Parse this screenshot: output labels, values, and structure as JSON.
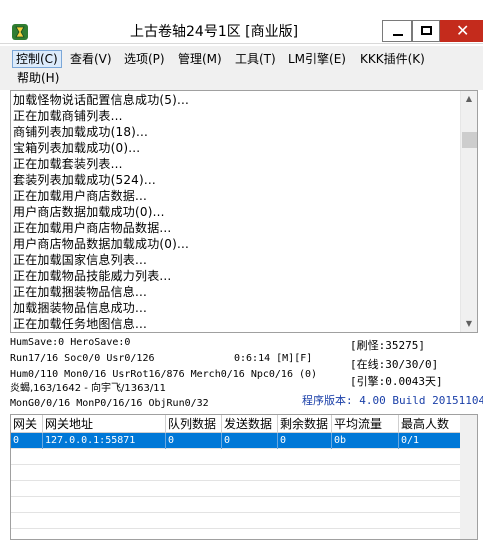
{
  "window": {
    "title": "上古卷轴24号1区 [商业版]",
    "close_glyph": "✕"
  },
  "menu": [
    {
      "label": "控制(C)",
      "active": true
    },
    {
      "label": "查看(V)"
    },
    {
      "label": "选项(P)"
    },
    {
      "label": "管理(M)"
    },
    {
      "label": "工具(T)"
    },
    {
      "label": "LM引擎(E)"
    },
    {
      "label": "KKK插件(K)"
    },
    {
      "label": "帮助(H)"
    }
  ],
  "log": [
    "加载怪物说话配置信息成功(5)...",
    "正在加载商铺列表...",
    "商铺列表加载成功(18)...",
    "宝箱列表加载成功(0)...",
    "正在加载套装列表...",
    "套装列表加载成功(524)...",
    "正在加载用户商店数据...",
    "用户商店数据加载成功(0)...",
    "正在加载用户商店物品数据...",
    "用户商店物品数据加载成功(0)...",
    "正在加载国家信息列表...",
    "正在加载物品技能威力列表...",
    "正在加载捆装物品信息...",
    "加载捆装物品信息成功...",
    "正在加载任务地图信息..."
  ],
  "status": {
    "line1": "HumSave:0 HeroSave:0",
    "line2_left": "Run17/16 Soc0/0 Usr0/126",
    "line2_time": "0:6:14 [M][F]",
    "line3": "Hum0/110 Mon0/16 UsrRot16/876 Merch0/16 Npc0/16 (0)",
    "line4": "炎蝎,163/1642 - 向宇飞/1363/11",
    "line5": "MonG0/0/16 MonP0/16/16 ObjRun0/32",
    "refresh": "[刷怪:35275]",
    "online": "[在线:30/30/0]",
    "engine": "[引擎:0.0043天]",
    "version": "程序版本: 4.00 Build 20151104"
  },
  "table": {
    "columns": [
      "网关",
      "网关地址",
      "队列数据",
      "发送数据",
      "剩余数据",
      "平均流量",
      "最高人数"
    ],
    "rows": [
      [
        "0",
        "127.0.0.1:55871",
        "0",
        "0",
        "0",
        "0b",
        "0/1"
      ]
    ]
  },
  "colors": {
    "selection": "#0078d7",
    "version_text": "#1a3fa8",
    "close_button": "#c42b1c"
  }
}
